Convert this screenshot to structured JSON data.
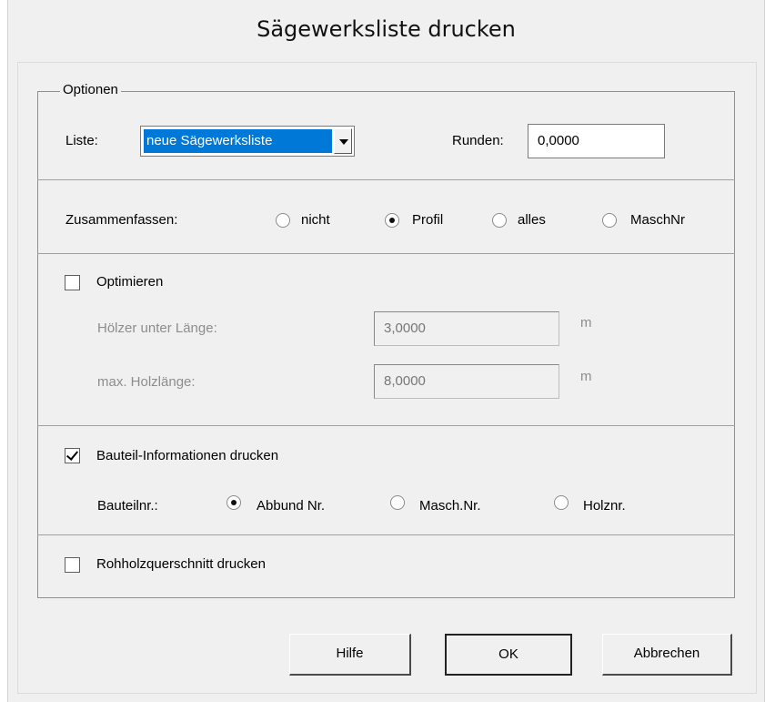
{
  "dialog": {
    "title": "Sägewerksliste drucken"
  },
  "options": {
    "legend": "Optionen",
    "list_label": "Liste:",
    "list_value": "neue Sägewerksliste",
    "round_label": "Runden:",
    "round_value": "0,0000"
  },
  "summarize": {
    "label": "Zusammenfassen:",
    "options": [
      "nicht",
      "Profil",
      "alles",
      "MaschNr"
    ],
    "selected": "Profil"
  },
  "optimize": {
    "label": "Optimieren",
    "checked": false,
    "shorter_label": "Hölzer unter Länge:",
    "shorter_value": "3,0000",
    "shorter_unit": "m",
    "maxlen_label": "max. Holzlänge:",
    "maxlen_value": "8,0000",
    "maxlen_unit": "m"
  },
  "part_info": {
    "label": "Bauteil-Informationen drucken",
    "checked": true,
    "number_label": "Bauteilnr.:",
    "options": [
      "Abbund Nr.",
      "Masch.Nr.",
      "Holznr."
    ],
    "selected": "Abbund Nr."
  },
  "raw_section": {
    "label": "Rohholzquerschnitt drucken",
    "checked": false
  },
  "buttons": {
    "help": "Hilfe",
    "ok": "OK",
    "cancel": "Abbrechen"
  },
  "colors": {
    "selection": "#0078d7",
    "dialog_bg": "#f0f0f0"
  }
}
